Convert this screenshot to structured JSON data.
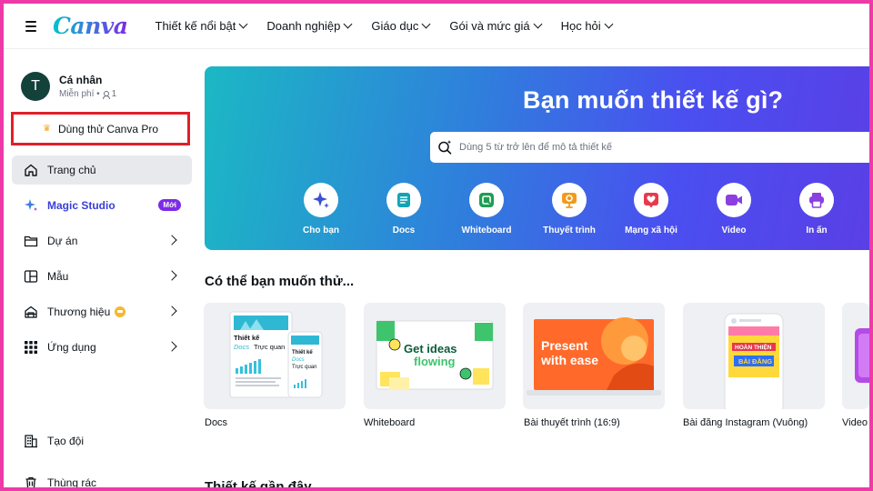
{
  "header": {
    "logo": "Canva",
    "nav": [
      {
        "label": "Thiết kế nổi bật"
      },
      {
        "label": "Doanh nghiệp"
      },
      {
        "label": "Giáo dục"
      },
      {
        "label": "Gói và mức giá"
      },
      {
        "label": "Học hỏi"
      }
    ]
  },
  "sidebar": {
    "avatar_letter": "T",
    "account_name": "Cá nhân",
    "account_plan": "Miễn phí •",
    "member_count": "1",
    "pro_button": "Dùng thử Canva Pro",
    "items": [
      {
        "label": "Trang chủ",
        "icon": "home-icon"
      },
      {
        "label": "Magic Studio",
        "icon": "sparkle-icon",
        "badge": "Mới"
      },
      {
        "label": "Dự án",
        "icon": "folder-icon"
      },
      {
        "label": "Mẫu",
        "icon": "template-icon"
      },
      {
        "label": "Thương hiệu",
        "icon": "brand-icon"
      },
      {
        "label": "Ứng dụng",
        "icon": "apps-grid-icon"
      },
      {
        "label": "Tạo đội",
        "icon": "building-icon"
      },
      {
        "label": "Thùng rác",
        "icon": "trash-icon"
      }
    ]
  },
  "hero": {
    "title": "Bạn muốn thiết kế gì?",
    "search_placeholder": "Dùng 5 từ trở lên để mô tả thiết kế",
    "categories": [
      {
        "label": "Cho bạn",
        "icon": "sparkle-icon",
        "color": "#3a4fd7"
      },
      {
        "label": "Docs",
        "icon": "docs-icon",
        "color": "#13a3b5"
      },
      {
        "label": "Whiteboard",
        "icon": "whiteboard-icon",
        "color": "#1f9d55"
      },
      {
        "label": "Thuyết trình",
        "icon": "presentation-icon",
        "color": "#f29a1b"
      },
      {
        "label": "Mạng xã hội",
        "icon": "heart-icon",
        "color": "#e8394d"
      },
      {
        "label": "Video",
        "icon": "video-icon",
        "color": "#8b3fe0"
      },
      {
        "label": "In ấn",
        "icon": "print-icon",
        "color": "#8b3fe0"
      }
    ]
  },
  "suggestions": {
    "title": "Có thể bạn muốn thử...",
    "cards": [
      {
        "label": "Docs",
        "thumb_text_1": "Thiết kế",
        "thumb_text_2": "Docs Trực quan"
      },
      {
        "label": "Whiteboard",
        "thumb_text_1": "Get ideas",
        "thumb_text_2": "flowing"
      },
      {
        "label": "Bài thuyết trình (16:9)",
        "thumb_text_1": "Present",
        "thumb_text_2": "with ease"
      },
      {
        "label": "Bài đăng Instagram (Vuông)",
        "thumb_text_1": "HOÀN THIỆN",
        "thumb_text_2": "BÀI ĐĂNG"
      },
      {
        "label": "Video"
      }
    ]
  },
  "recent": {
    "title": "Thiết kế gần đây"
  },
  "colors": {
    "accent": "#7d2ae8",
    "frame": "#ee3aa8",
    "highlight_box": "#e0202a"
  }
}
